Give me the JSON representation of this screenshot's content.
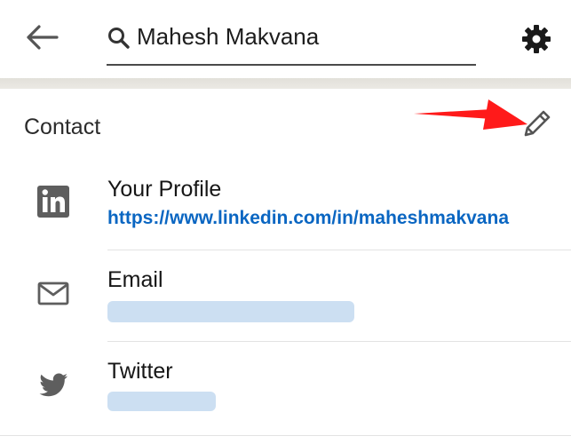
{
  "header": {
    "back_icon": "arrow-left-icon",
    "search": {
      "value": "Mahesh Makvana",
      "icon": "search-icon"
    },
    "settings_icon": "gear-icon"
  },
  "contact": {
    "title": "Contact",
    "edit_icon": "pencil-icon",
    "annotation_color": "#ff0000",
    "items": [
      {
        "icon": "linkedin-icon",
        "label": "Your Profile",
        "value": "https://www.linkedin.com/in/maheshmakvana"
      },
      {
        "icon": "email-icon",
        "label": "Email",
        "value_blurred": true
      },
      {
        "icon": "twitter-icon",
        "label": "Twitter",
        "value_blurred": true
      }
    ]
  },
  "colors": {
    "link": "#0a66c2",
    "icon": "#5e5e5e",
    "divider_band": "#e6e4df"
  }
}
